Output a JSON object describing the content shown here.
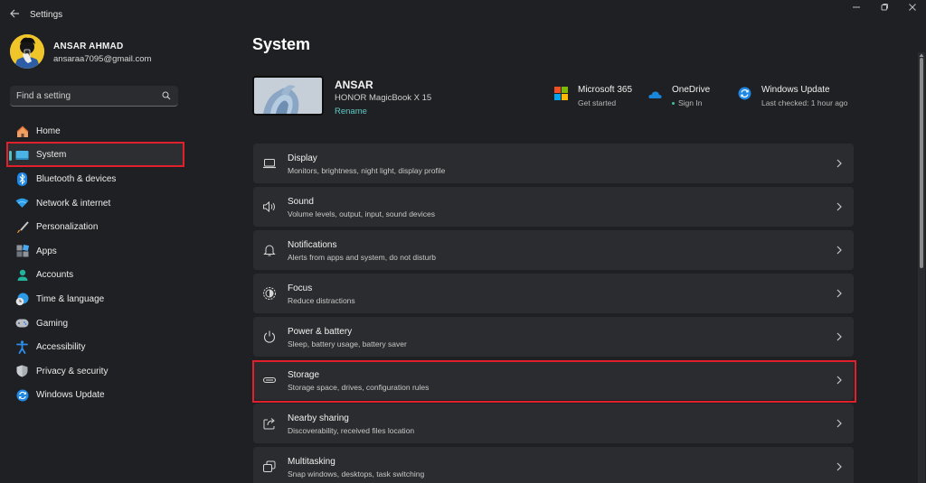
{
  "window": {
    "app_title": "Settings",
    "controls": {
      "minimize": "—",
      "maximize": "❐",
      "close": "✕"
    }
  },
  "profile": {
    "name": "ANSAR AHMAD",
    "email": "ansaraa7095@gmail.com"
  },
  "search": {
    "placeholder": "Find a setting",
    "value": ""
  },
  "sidebar": {
    "selected": "System",
    "items": [
      {
        "label": "Home",
        "icon": "home-icon"
      },
      {
        "label": "System",
        "icon": "system-icon",
        "active": true
      },
      {
        "label": "Bluetooth & devices",
        "icon": "bluetooth-icon"
      },
      {
        "label": "Network & internet",
        "icon": "wifi-icon"
      },
      {
        "label": "Personalization",
        "icon": "brush-icon"
      },
      {
        "label": "Apps",
        "icon": "apps-icon"
      },
      {
        "label": "Accounts",
        "icon": "accounts-icon"
      },
      {
        "label": "Time & language",
        "icon": "time-language-icon"
      },
      {
        "label": "Gaming",
        "icon": "gaming-icon"
      },
      {
        "label": "Accessibility",
        "icon": "accessibility-icon"
      },
      {
        "label": "Privacy & security",
        "icon": "shield-icon"
      },
      {
        "label": "Windows Update",
        "icon": "windows-update-icon"
      }
    ]
  },
  "main": {
    "title": "System",
    "device": {
      "name": "ANSAR",
      "model": "HONOR MagicBook X 15",
      "rename_label": "Rename"
    },
    "quick_links": [
      {
        "title": "Microsoft 365",
        "subtitle": "Get started",
        "icon": "microsoft-365-icon"
      },
      {
        "title": "OneDrive",
        "subtitle": "Sign In",
        "icon": "onedrive-icon"
      },
      {
        "title": "Windows Update",
        "subtitle": "Last checked: 1 hour ago",
        "icon": "windows-update-icon"
      }
    ],
    "settings": [
      {
        "title": "Display",
        "subtitle": "Monitors, brightness, night light, display profile",
        "icon": "display-icon"
      },
      {
        "title": "Sound",
        "subtitle": "Volume levels, output, input, sound devices",
        "icon": "sound-icon"
      },
      {
        "title": "Notifications",
        "subtitle": "Alerts from apps and system, do not disturb",
        "icon": "bell-icon"
      },
      {
        "title": "Focus",
        "subtitle": "Reduce distractions",
        "icon": "focus-icon"
      },
      {
        "title": "Power & battery",
        "subtitle": "Sleep, battery usage, battery saver",
        "icon": "power-icon"
      },
      {
        "title": "Storage",
        "subtitle": "Storage space, drives, configuration rules",
        "icon": "storage-icon",
        "highlighted": true
      },
      {
        "title": "Nearby sharing",
        "subtitle": "Discoverability, received files location",
        "icon": "share-icon"
      },
      {
        "title": "Multitasking",
        "subtitle": "Snap windows, desktops, task switching",
        "icon": "multitasking-icon"
      }
    ]
  },
  "colors": {
    "accent": "#4cc2c4",
    "link": "#5fc9c4",
    "highlight": "#e0202a",
    "background": "#1f2023",
    "card": "#2b2c2f"
  }
}
